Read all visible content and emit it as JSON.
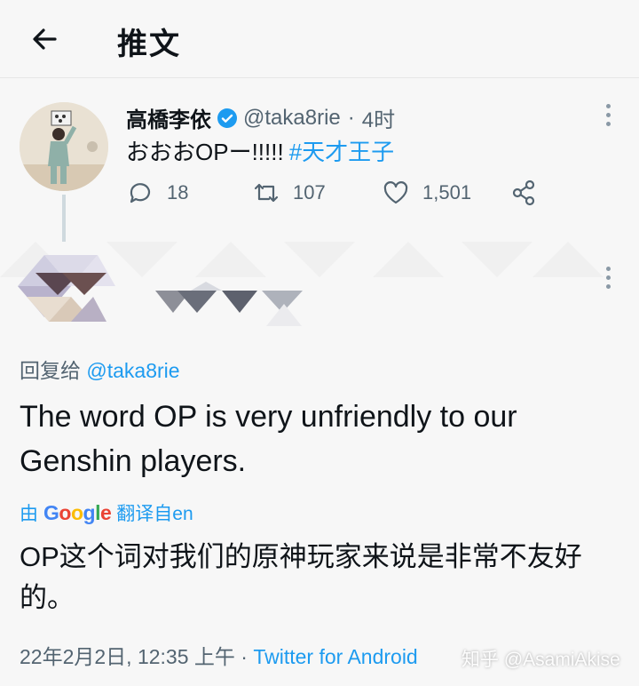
{
  "header": {
    "title": "推文"
  },
  "tweet": {
    "author_name": "高橋李依",
    "handle": "@taka8rie",
    "separator": "·",
    "time": "4时",
    "text": "おおおOPー!!!!!",
    "hashtag": "#天才王子",
    "replies": "18",
    "retweets": "107",
    "likes": "1,501"
  },
  "reply": {
    "reply_to_prefix": "回复给",
    "reply_to_handle": "@taka8rie",
    "text": "The word OP is very unfriendly to our Genshin players.",
    "translate_prefix": "由",
    "translate_logo": "Google",
    "translate_suffix": "翻译自en",
    "translated_text": "OP这个词对我们的原神玩家来说是非常不友好的。",
    "timestamp": "22年2月2日, 12:35 上午",
    "footer_separator": "·",
    "source": "Twitter for Android"
  },
  "watermark": "知乎 @AsamiAkise",
  "colors": {
    "accent": "#1d9bf0",
    "text": "#0f1419",
    "secondary": "#536471",
    "background": "#f7f7f7"
  }
}
